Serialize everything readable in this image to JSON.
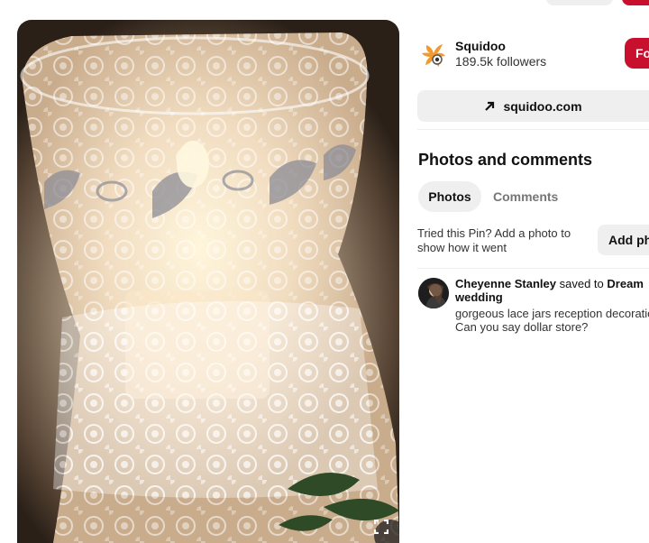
{
  "creator": {
    "name": "Squidoo",
    "followers": "189.5k followers",
    "follow_label": "Fo"
  },
  "visit_site": {
    "label": "squidoo.com",
    "icon": "arrow-up-right-icon"
  },
  "comments_section": {
    "title": "Photos and comments",
    "tabs": [
      {
        "label": "Photos",
        "active": true
      },
      {
        "label": "Comments",
        "active": false
      }
    ],
    "tried_prompt": "Tried this Pin? Add a photo to show how it went",
    "add_photo_label": "Add ph"
  },
  "activity": {
    "user": "Cheyenne Stanley",
    "action": "saved to",
    "board": "Dream wedding",
    "description_line1": "gorgeous lace jars reception decoratio",
    "description_line2": "Can you say dollar store?"
  },
  "image": {
    "icon": "expand-icon"
  },
  "colors": {
    "brand_red": "#c8102e",
    "button_grey": "#efefef",
    "muted_text": "#767676"
  }
}
